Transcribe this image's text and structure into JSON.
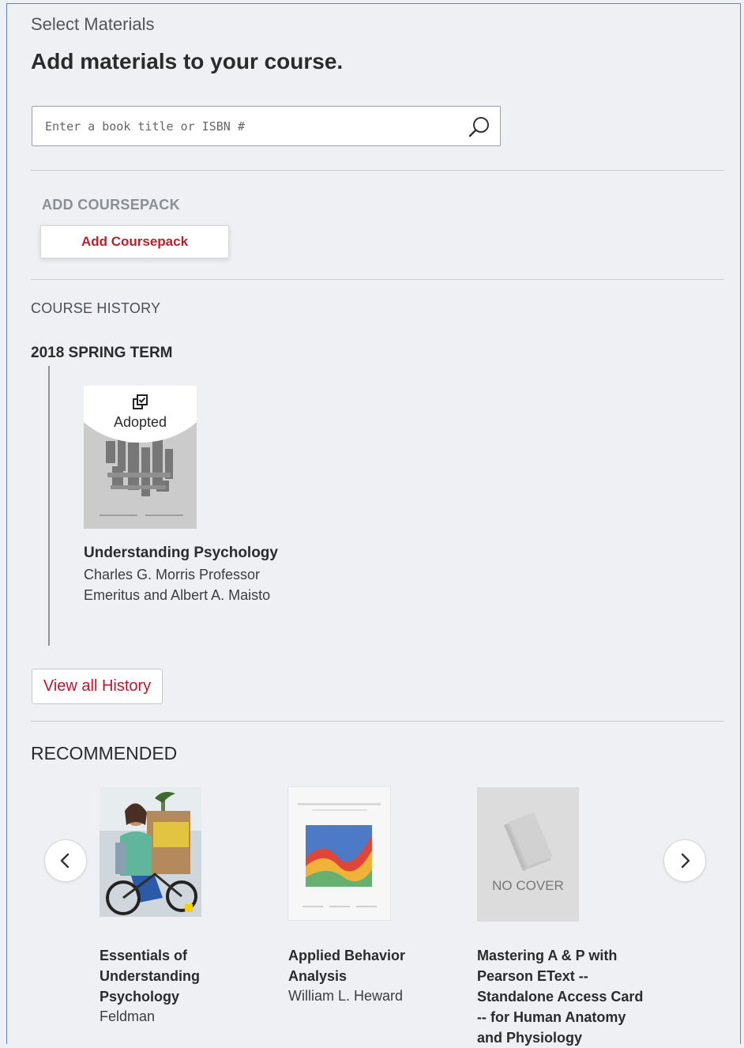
{
  "page": {
    "eyebrow": "Select Materials",
    "headline": "Add materials to your course."
  },
  "search": {
    "placeholder": "Enter a book title or ISBN #",
    "icon": "search-icon"
  },
  "coursepack": {
    "label": "ADD COURSEPACK",
    "button_label": "Add Coursepack"
  },
  "history": {
    "section_label": "COURSE HISTORY",
    "term": "2018 SPRING TERM",
    "items": [
      {
        "badge": "Adopted",
        "badge_icon": "adopted-icon",
        "title": "Understanding Psychology",
        "author": "Charles G. Morris Professor Emeritus and Albert A. Maisto"
      }
    ],
    "view_all_label": "View all History"
  },
  "recommended": {
    "section_label": "RECOMMENDED",
    "prev_icon": "chevron-left-icon",
    "next_icon": "chevron-right-icon",
    "items": [
      {
        "title": "Essentials of Understanding Psychology",
        "author": "Feldman"
      },
      {
        "title": "Applied Behavior Analysis",
        "author": "William L. Heward"
      },
      {
        "title": "Mastering A & P with Pearson EText -- Standalone Access Card -- for Human Anatomy and Physiology",
        "author": "",
        "cover_text": "NO COVER"
      }
    ]
  },
  "colors": {
    "accent_red": "#c3132b",
    "page_bg": "#eef0f4",
    "frame_border": "#5a86c8"
  }
}
